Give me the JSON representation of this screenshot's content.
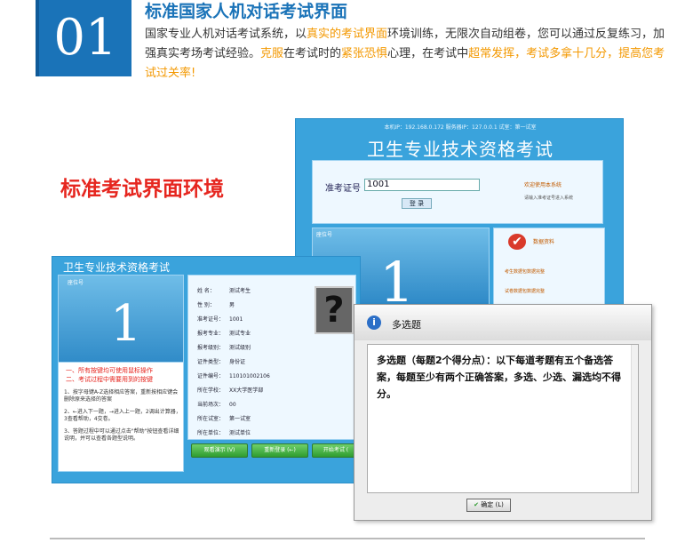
{
  "header": {
    "badge": "01",
    "title": "标准国家人机对话考试界面",
    "desc_parts": [
      {
        "t": "国家专业人机对话考试系统，以",
        "hl": false
      },
      {
        "t": "真实的考试界面",
        "hl": true
      },
      {
        "t": "环境训练，无限次自动组卷，您可以通过反复练习，加强真实考场考试经验。",
        "hl": false
      },
      {
        "t": "克服",
        "hl": true
      },
      {
        "t": "在考试时的",
        "hl": false
      },
      {
        "t": "紧张恐惧",
        "hl": true
      },
      {
        "t": "心理，在考试中",
        "hl": false
      },
      {
        "t": "超常发挥，考试多拿十几分，提高您考试过关率!",
        "hl": true
      }
    ]
  },
  "overlay_title": "标准考试界面环境",
  "login_window": {
    "status": "本机IP：192.168.0.172    服务器IP：127.0.0.1    试室：第一试室",
    "title": "卫生专业技术资格考试",
    "id_label": "准考证号",
    "id_value": "1001",
    "login_button": "登 录",
    "welcome": "欢迎使用本系统",
    "hint": "请输入准考证号进入系统",
    "seat_label": "座位号",
    "seat_number": "1",
    "right_heading": "数据资料",
    "link1": "考生数据包数据完整",
    "link2": "试卷数据包数据完整"
  },
  "info_window": {
    "title": "卫生专业技术资格考试",
    "seat_label": "座位号",
    "seat_number": "1",
    "note1": "一、所有按键均可使用鼠标操作",
    "note2": "二、考试过程中需要用到的按键",
    "steps": [
      "1、按字母键A-Z选择相应答案，重新按相应键会删除原来选择的答案",
      "2、←进入下一题，→进入上一题，2调出计算器，3查看帮助，4交卷。",
      "3、答题过程中可以通过点击\"帮助\"按钮查看详细说明，并可以查看各题型说明。",
      ""
    ],
    "fields": [
      {
        "k": "姓    名：",
        "v": "测试考生"
      },
      {
        "k": "性    别：",
        "v": "男"
      },
      {
        "k": "准考证号：",
        "v": "1001"
      },
      {
        "k": "报考专业：",
        "v": "测试专业"
      },
      {
        "k": "报考级别：",
        "v": "测试级别"
      },
      {
        "k": "证件类型：",
        "v": "身份证"
      },
      {
        "k": "证件编号：",
        "v": "110101002106"
      },
      {
        "k": "所在学校：",
        "v": "XX大学医学部"
      },
      {
        "k": "当前场次：",
        "v": "00"
      },
      {
        "k": "所在试室：",
        "v": "第一试室"
      },
      {
        "k": "所在单位：",
        "v": "测试单位"
      }
    ],
    "btn_demo": "观看演示 (V)",
    "btn_relogin": "重新登录 (←)",
    "btn_start": "开始考试 ("
  },
  "dialog": {
    "title": "多选题",
    "body": "多选题（每题2个得分点）：以下每道考题有五个备选答案，每题至少有两个正确答案，多选、少选、漏选均不得分。",
    "ok": "确定 (L)"
  },
  "colors": {
    "accent": "#1a73b8",
    "highlight": "#f39800",
    "red": "#e6261f",
    "window": "#3aa3dc"
  }
}
